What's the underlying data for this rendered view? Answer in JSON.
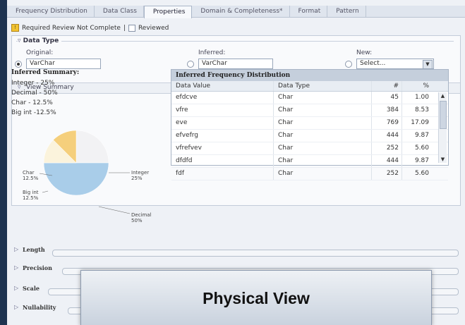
{
  "tabs": [
    "Frequency Distribution",
    "Data Class",
    "Properties",
    "Domain & Completeness*",
    "Format",
    "Pattern"
  ],
  "active_tab": 2,
  "review": {
    "warning": "Required Review Not Complete",
    "separator": "|",
    "reviewed_label": "Reviewed"
  },
  "data_type": {
    "legend": "Data Type",
    "original_label": "Original:",
    "original_value": "VarChar",
    "inferred_label": "Inferred:",
    "inferred_value": "VarChar",
    "new_label": "New:",
    "new_value": "Select...",
    "selected_radio": "original"
  },
  "view_summary_label": "View Summary",
  "inferred_summary": {
    "title": "Inferred Summary:",
    "lines": [
      "Integer - 25%",
      "Decimal - 50%",
      "Char - 12.5%",
      "Big int -12.5%"
    ]
  },
  "pie_labels": {
    "char": "Char 12.5%",
    "bigint": "Big int 12.5%",
    "integer": "Integer 25%",
    "decimal": "Decimal 50%"
  },
  "chart_data": {
    "type": "pie",
    "categories": [
      "Integer",
      "Decimal",
      "Char",
      "Big int"
    ],
    "values": [
      25,
      50,
      12.5,
      12.5
    ],
    "colors": [
      "#f2f2f4",
      "#a9cde9",
      "#f5cf7c",
      "#fbf3dc"
    ]
  },
  "freq_table": {
    "title": "Inferred Frequency Distribution",
    "columns": [
      "Data Value",
      "Data Type",
      "#",
      "%"
    ],
    "rows": [
      [
        "efdcve",
        "Char",
        "45",
        "1.00"
      ],
      [
        "vfre",
        "Char",
        "384",
        "8.53"
      ],
      [
        "eve",
        "Char",
        "769",
        "17.09"
      ],
      [
        "efvefrg",
        "Char",
        "444",
        "9.87"
      ],
      [
        "vfrefvev",
        "Char",
        "252",
        "5.60"
      ],
      [
        "dfdfd",
        "Char",
        "444",
        "9.87"
      ],
      [
        "fdf",
        "Char",
        "252",
        "5.60"
      ]
    ]
  },
  "sections": [
    "Length",
    "Precision",
    "Scale",
    "Nullability"
  ],
  "overlay_title": "Physical View"
}
